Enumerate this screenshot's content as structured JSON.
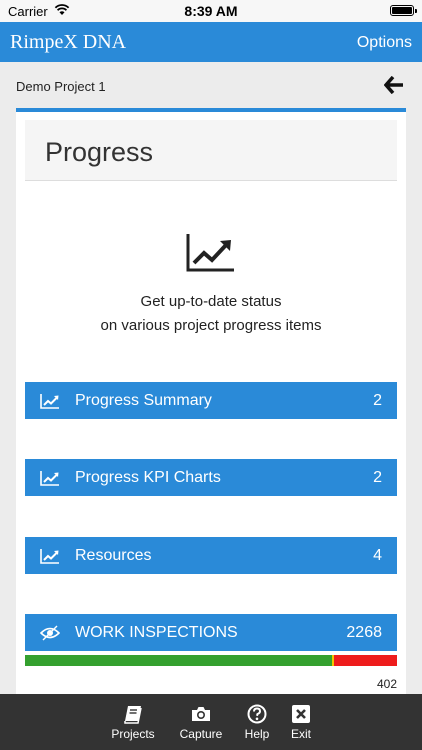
{
  "status_bar": {
    "carrier": "Carrier",
    "time": "8:39 AM"
  },
  "header": {
    "title": "RimpeX DNA",
    "options_label": "Options"
  },
  "project": {
    "name": "Demo Project 1"
  },
  "card": {
    "title": "Progress",
    "hero_line1": "Get up-to-date status",
    "hero_line2": "on various project progress items"
  },
  "menu": [
    {
      "label": "Progress Summary",
      "count": "2",
      "icon": "chart-line-icon"
    },
    {
      "label": "Progress KPI Charts",
      "count": "2",
      "icon": "chart-line-icon"
    },
    {
      "label": "Resources",
      "count": "4",
      "icon": "chart-line-icon"
    },
    {
      "label": "WORK INSPECTIONS",
      "count": "2268",
      "icon": "eye-icon"
    }
  ],
  "inspection_progress": {
    "green_fraction": 0.824,
    "yellow_fraction": 0.008,
    "red_fraction": 0.168,
    "count": "402"
  },
  "tabs": [
    {
      "label": "Projects",
      "icon": "book-icon"
    },
    {
      "label": "Capture",
      "icon": "camera-icon"
    },
    {
      "label": "Help",
      "icon": "help-icon"
    },
    {
      "label": "Exit",
      "icon": "close-icon"
    }
  ],
  "colors": {
    "accent": "#2a8ad8",
    "tab_bar": "#333333",
    "green": "#34a02f",
    "yellow": "#f2c500",
    "red": "#ee1c1c"
  }
}
